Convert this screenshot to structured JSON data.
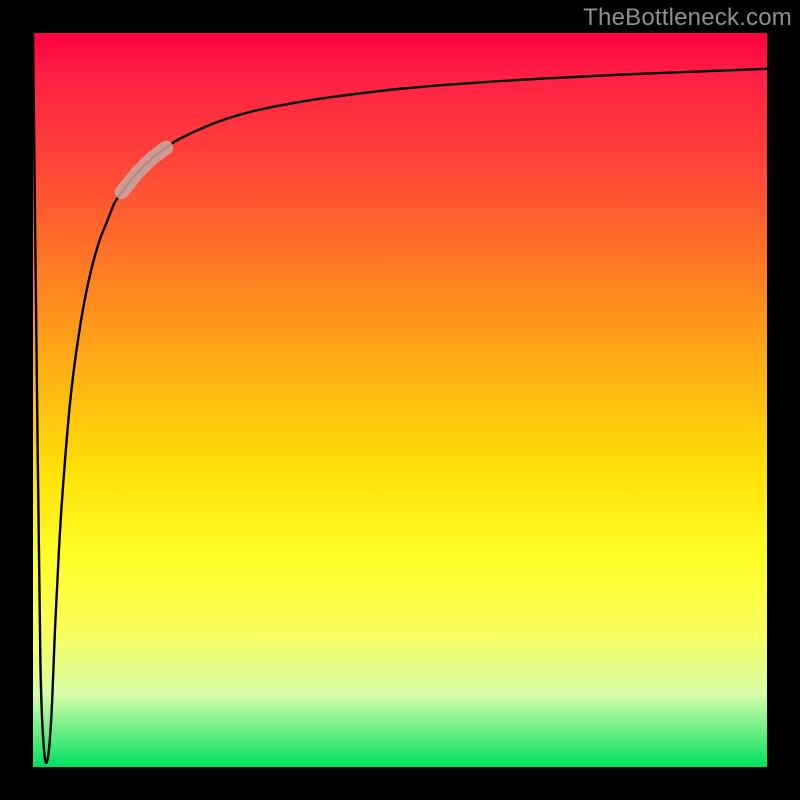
{
  "watermark": {
    "text": "TheBottleneck.com"
  },
  "chart_data": {
    "type": "line",
    "title": "",
    "xlabel": "",
    "ylabel": "",
    "xlim": [
      0,
      100
    ],
    "ylim": [
      0,
      100
    ],
    "background_gradient": "red-orange-yellow-green (top to bottom)",
    "series": [
      {
        "name": "curve",
        "x": [
          0,
          0.5,
          1,
          1.5,
          2,
          2.5,
          3,
          3.5,
          4,
          5,
          6,
          7,
          8,
          9,
          10,
          11,
          12,
          14,
          16,
          18,
          20,
          25,
          30,
          35,
          40,
          50,
          60,
          70,
          80,
          90,
          100
        ],
        "y": [
          100,
          55,
          15,
          3,
          2,
          8,
          20,
          30,
          38,
          50,
          58,
          64,
          68.5,
          72,
          74.5,
          77,
          78.5,
          81,
          83,
          84.5,
          85.8,
          88,
          89.5,
          90.5,
          91.3,
          92.5,
          93.3,
          93.9,
          94.4,
          94.8,
          95.2
        ]
      }
    ],
    "highlight_segment": {
      "x_range": [
        12,
        18
      ],
      "color": "#c9a9a4",
      "opacity": 0.85,
      "description": "short, pale rounded overlay on curve around x≈13–17"
    }
  }
}
